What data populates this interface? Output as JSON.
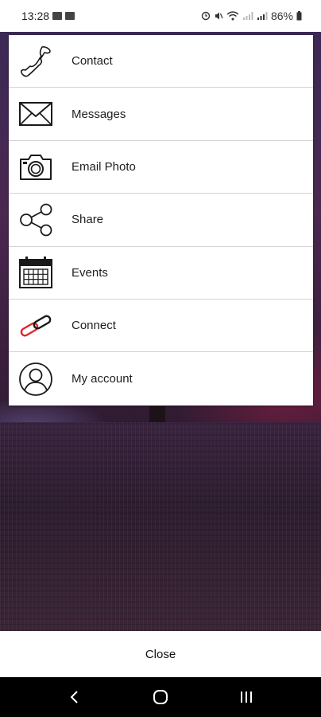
{
  "status_bar": {
    "time": "13:28",
    "battery": "86%",
    "icons": [
      "notification-icon",
      "notification-icon",
      "alarm-icon",
      "mute-icon",
      "wifi-icon",
      "signal-icon",
      "signal-icon",
      "battery-icon"
    ]
  },
  "menu": {
    "items": [
      {
        "label": "Contact",
        "icon": "phone-icon"
      },
      {
        "label": "Messages",
        "icon": "envelope-icon"
      },
      {
        "label": "Email Photo",
        "icon": "camera-icon"
      },
      {
        "label": "Share",
        "icon": "share-icon"
      },
      {
        "label": "Events",
        "icon": "calendar-icon"
      },
      {
        "label": "Connect",
        "icon": "link-icon"
      },
      {
        "label": "My account",
        "icon": "user-icon"
      }
    ]
  },
  "close_label": "Close",
  "nav": {
    "buttons": [
      "back-icon",
      "home-icon",
      "recents-icon"
    ]
  },
  "colors": {
    "link_red": "#e0262b",
    "icon_dark": "#1a1a1a"
  }
}
